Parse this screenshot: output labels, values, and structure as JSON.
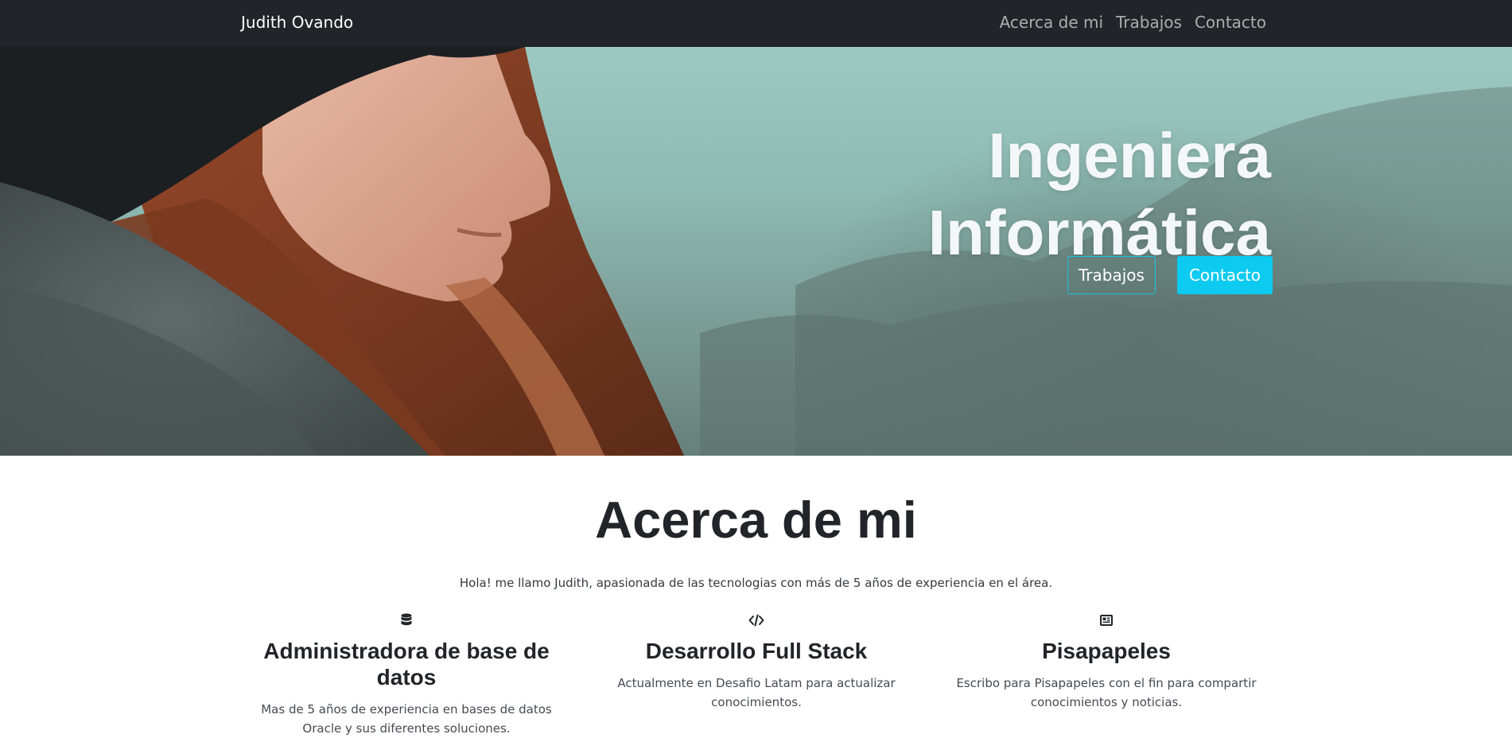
{
  "navbar": {
    "brand": "Judith Ovando",
    "links": [
      "Acerca de mi",
      "Trabajos",
      "Contacto"
    ]
  },
  "hero": {
    "title_line1": "Ingeniera",
    "title_line2": "Informática",
    "buttons": {
      "secondary": "Trabajos",
      "primary": "Contacto"
    }
  },
  "about": {
    "title": "Acerca de mi",
    "intro": "Hola! me llamo Judith, apasionada de las tecnologias con más de 5 años de experiencia en el área.",
    "features": [
      {
        "icon": "database-icon",
        "title": "Administradora de base de datos",
        "text": "Mas de 5 años de experiencia en bases de datos Oracle y sus diferentes soluciones."
      },
      {
        "icon": "code-icon",
        "title": "Desarrollo Full Stack",
        "text": "Actualmente en Desafio Latam para actualizar conocimientos."
      },
      {
        "icon": "newspaper-icon",
        "title": "Pisapapeles",
        "text": "Escribo para Pisapapeles con el fin para compartir conocimientos y noticias."
      }
    ]
  },
  "colors": {
    "navbar_bg": "#212529",
    "accent": "#0dcaf0",
    "text_dark": "#212529"
  }
}
